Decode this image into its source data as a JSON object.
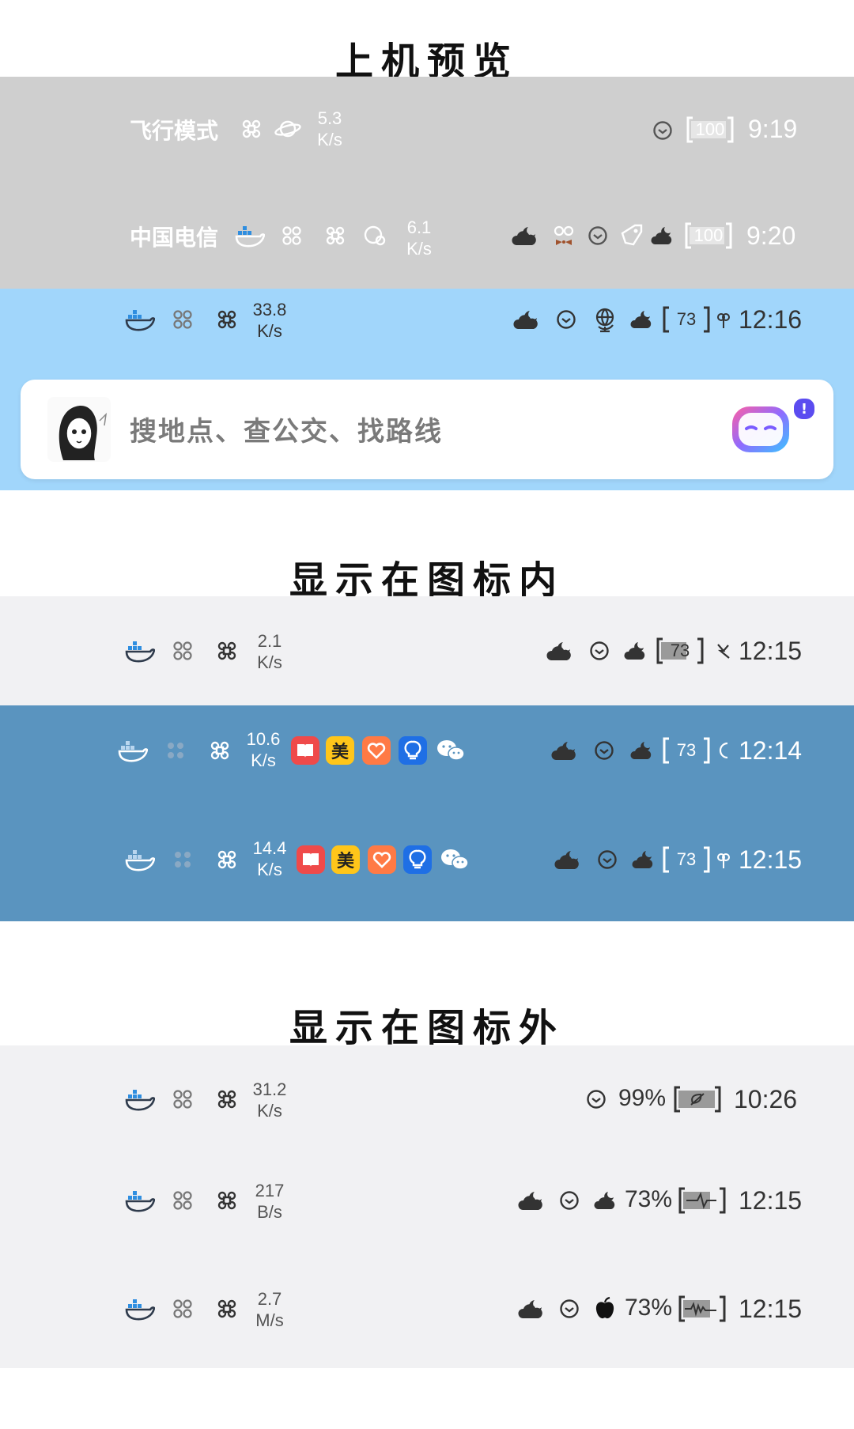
{
  "headings": {
    "preview": "上机预览",
    "inside": "显示在图标内",
    "outside": "显示在图标外"
  },
  "colors": {
    "gray_band": "#cfcfcf",
    "light_blue_band": "#a1d6fb",
    "light_gray_band": "#f1f1f3",
    "steel_blue_band": "#5a94bf",
    "white_text": "#ffffff",
    "dark_icon": "#333333",
    "docker_blue": "#2f8ee0"
  },
  "rows": {
    "r1": {
      "carrier": "飞行模式",
      "speed_value": "5.3",
      "speed_unit": "K/s",
      "battery": "100",
      "time": "9:19"
    },
    "r2": {
      "carrier": "中国电信",
      "speed_value": "6.1",
      "speed_unit": "K/s",
      "battery": "100",
      "time": "9:20"
    },
    "r3": {
      "speed_value": "33.8",
      "speed_unit": "K/s",
      "battery": "73",
      "time": "12:16"
    },
    "r4": {
      "speed_value": "2.1",
      "speed_unit": "K/s",
      "battery": "73",
      "time": "12:15"
    },
    "r5": {
      "speed_value": "10.6",
      "speed_unit": "K/s",
      "battery": "73",
      "time": "12:14",
      "app_badge": "美"
    },
    "r6": {
      "speed_value": "14.4",
      "speed_unit": "K/s",
      "battery": "73",
      "time": "12:15",
      "app_badge": "美"
    },
    "r7": {
      "speed_value": "31.2",
      "speed_unit": "K/s",
      "battery_percent": "99%",
      "time": "10:26"
    },
    "r8": {
      "speed_value": "217",
      "speed_unit": "B/s",
      "battery_percent": "73%",
      "time": "12:15"
    },
    "r9": {
      "speed_value": "2.7",
      "speed_unit": "M/s",
      "battery_percent": "73%",
      "time": "12:15"
    }
  },
  "search": {
    "placeholder": "搜地点、查公交、找路线",
    "notification_badge": "!"
  }
}
